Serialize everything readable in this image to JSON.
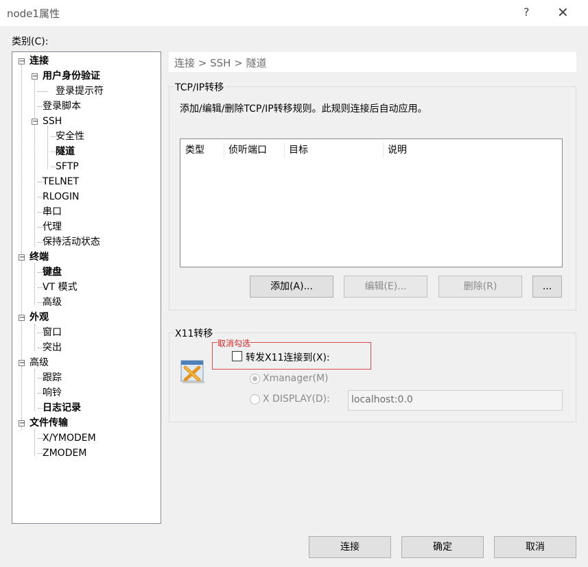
{
  "window": {
    "title": "node1属性",
    "help": "?",
    "close": "✕"
  },
  "category_label": "类别(C):",
  "tree": {
    "connection": "连接",
    "user_auth": "用户身份验证",
    "login_prompt": "登录提示符",
    "login_script": "登录脚本",
    "ssh": "SSH",
    "security": "安全性",
    "tunnel": "隧道",
    "sftp": "SFTP",
    "telnet": "TELNET",
    "rlogin": "RLOGIN",
    "serial": "串口",
    "proxy": "代理",
    "keepalive": "保持活动状态",
    "terminal": "终端",
    "keyboard": "键盘",
    "vt_mode": "VT 模式",
    "advanced": "高级",
    "appearance": "外观",
    "window": "窗口",
    "highlight": "突出",
    "advanced2": "高级",
    "trace": "跟踪",
    "bell": "响铃",
    "logging": "日志记录",
    "file_transfer": "文件传输",
    "xymodem": "X/YMODEM",
    "zmodem": "ZMODEM"
  },
  "breadcrumb": "连接 > SSH > 隧道",
  "tcpip": {
    "title": "TCP/IP转移",
    "description": "添加/编辑/删除TCP/IP转移规则。此规则连接后自动应用。",
    "columns": [
      "类型",
      "侦听端口",
      "目标",
      "说明"
    ],
    "add": "添加(A)...",
    "edit": "编辑(E)...",
    "delete": "删除(R)",
    "more": "..."
  },
  "x11": {
    "title": "X11转移",
    "annotation": "取消勾选",
    "forward_label": "转发X11连接到(X):",
    "xmanager": "Xmanager(M)",
    "xdisplay": "X DISPLAY(D):",
    "display_value": "localhost:0.0"
  },
  "footer": {
    "connect": "连接",
    "ok": "确定",
    "cancel": "取消"
  }
}
